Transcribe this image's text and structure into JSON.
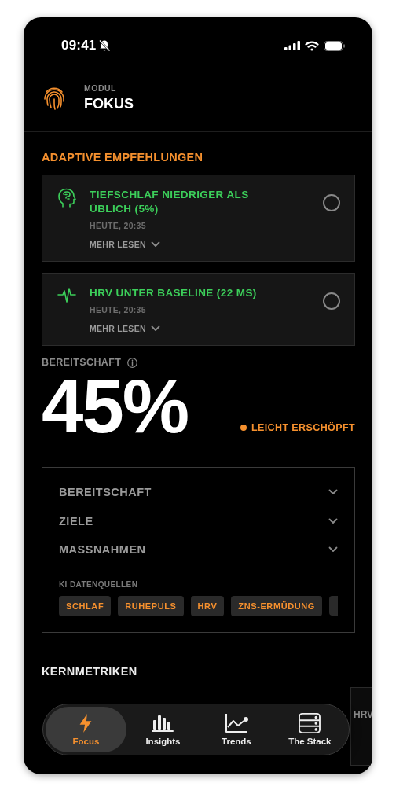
{
  "status_bar": {
    "time": "09:41",
    "silent": true
  },
  "header": {
    "overline": "MODUL",
    "title": "FOKUS"
  },
  "recommendations": {
    "title": "ADAPTIVE EMPFEHLUNGEN",
    "items": [
      {
        "kind": "brain",
        "title": "TIEFSCHLAF NIEDRIGER ALS ÜBLICH (5%)",
        "time": "HEUTE, 20:35",
        "more": "MEHR LESEN",
        "checked": false
      },
      {
        "kind": "pulse",
        "title": "HRV UNTER BASELINE (22 MS)",
        "time": "HEUTE, 20:35",
        "more": "MEHR LESEN",
        "checked": false
      }
    ]
  },
  "readiness": {
    "label": "BEREITSCHAFT",
    "value": "45%",
    "status": "LEICHT ERSCHÖPFT",
    "color": "#f5902e"
  },
  "accordion": {
    "sections": [
      {
        "label": "BEREITSCHAFT",
        "expanded": false
      },
      {
        "label": "ZIELE",
        "expanded": false
      },
      {
        "label": "MASSNAHMEN",
        "expanded": false
      }
    ],
    "sources_title": "KI DATENQUELLEN",
    "sources": [
      "SCHLAF",
      "RUHEPULS",
      "HRV",
      "ZNS-ERMÜDUNG"
    ],
    "sources_overflow": true
  },
  "metrics": {
    "title": "KERNMETRIKEN",
    "cards": [
      {
        "kind": "card",
        "title": "HRV"
      }
    ]
  },
  "tab_bar": [
    {
      "kind": "bolt",
      "label": "Focus",
      "selected": true
    },
    {
      "kind": "bars",
      "label": "Insights",
      "selected": false
    },
    {
      "kind": "trend",
      "label": "Trends",
      "selected": false
    },
    {
      "kind": "stack",
      "label": "The Stack",
      "selected": false
    }
  ]
}
